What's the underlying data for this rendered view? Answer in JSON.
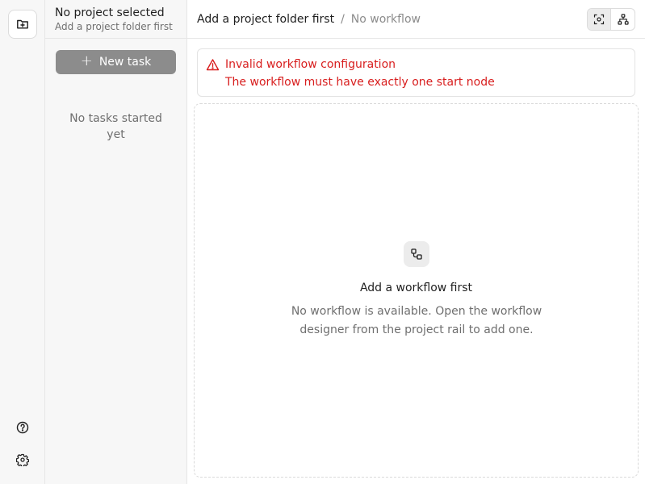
{
  "rail": {
    "top_icon": "folder-plus-icon",
    "bottom_icons": [
      "help-circle-icon",
      "settings-gear-icon"
    ]
  },
  "sidebar": {
    "project_title": "No project selected",
    "project_subtitle": "Add a project folder first",
    "new_task_label": "New task",
    "empty_tasks": "No tasks started yet"
  },
  "header": {
    "breadcrumb_project": "Add a project folder first",
    "breadcrumb_separator": "/",
    "breadcrumb_workflow": "No workflow",
    "view_buttons": [
      "focus-view-icon",
      "workflow-graph-icon"
    ]
  },
  "alert": {
    "icon": "warning-triangle-icon",
    "title": "Invalid workflow configuration",
    "message": "The workflow must have exactly one start node",
    "color": "#d81e1e"
  },
  "empty_state": {
    "icon": "workflow-icon",
    "title": "Add a workflow first",
    "description": "No workflow is available. Open the workflow designer from the project rail to add one."
  }
}
